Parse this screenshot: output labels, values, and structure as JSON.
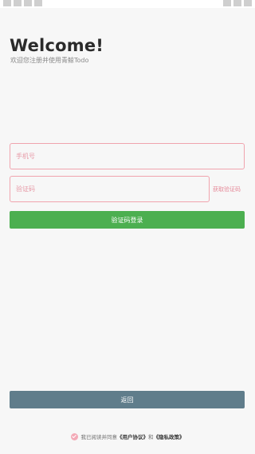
{
  "header": {
    "title": "Welcome!",
    "subtitle": "欢迎您注册并使用青鲸Todo"
  },
  "form": {
    "phone_placeholder": "手机号",
    "code_placeholder": "验证码",
    "get_code_label": "获取验证码",
    "login_button_label": "验证码登录"
  },
  "footer": {
    "back_button_label": "返回",
    "agreement_prefix": "我已阅读并同意",
    "user_agreement": "《用户协议》",
    "and_text": "和",
    "privacy_policy": "《隐私政策》"
  },
  "colors": {
    "accent_green": "#4caf50",
    "back_button": "#607d8b",
    "input_border": "#f0a4ae",
    "checkbox": "#f3aab7"
  }
}
